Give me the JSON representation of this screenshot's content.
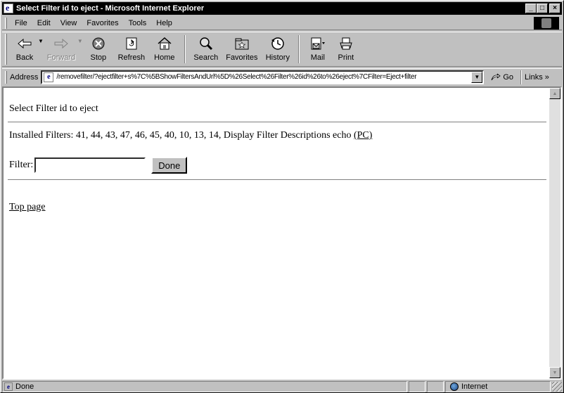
{
  "window": {
    "title": "Select Filter id to eject - Microsoft Internet Explorer",
    "controls": {
      "minimize": "_",
      "maximize": "□",
      "close": "×"
    }
  },
  "menu": {
    "items": [
      {
        "label": "File"
      },
      {
        "label": "Edit"
      },
      {
        "label": "View"
      },
      {
        "label": "Favorites"
      },
      {
        "label": "Tools"
      },
      {
        "label": "Help"
      }
    ]
  },
  "toolbar": {
    "buttons": [
      {
        "label": "Back",
        "icon": "back-arrow-icon",
        "enabled": true
      },
      {
        "label": "Forward",
        "icon": "forward-arrow-icon",
        "enabled": false
      },
      {
        "label": "Stop",
        "icon": "stop-icon",
        "enabled": true
      },
      {
        "label": "Refresh",
        "icon": "refresh-icon",
        "enabled": true
      },
      {
        "label": "Home",
        "icon": "home-icon",
        "enabled": true
      },
      {
        "label": "Search",
        "icon": "search-icon",
        "enabled": true
      },
      {
        "label": "Favorites",
        "icon": "favorites-icon",
        "enabled": true
      },
      {
        "label": "History",
        "icon": "history-icon",
        "enabled": true
      },
      {
        "label": "Mail",
        "icon": "mail-icon",
        "enabled": true
      },
      {
        "label": "Print",
        "icon": "print-icon",
        "enabled": true
      }
    ]
  },
  "address": {
    "label": "Address",
    "value": "/removefilter/?ejectfilter+s%7C%5BShowFiltersAndUrl%5D%26Select%26Filter%26id%26to%26eject%7CFilter=Eject+filter",
    "go_label": "Go",
    "links_label": "Links »"
  },
  "page": {
    "heading": "Select Filter id to eject",
    "installed_text": "Installed Filters: 41, 44, 43, 47, 46, 45, 40, 10, 13, 14, Display Filter Descriptions echo ",
    "installed_link": "(PC)",
    "filter_label": "Filter:",
    "filter_value": "",
    "done_label": "Done",
    "top_link": "Top page"
  },
  "status": {
    "text": "Done",
    "zone": "Internet"
  }
}
